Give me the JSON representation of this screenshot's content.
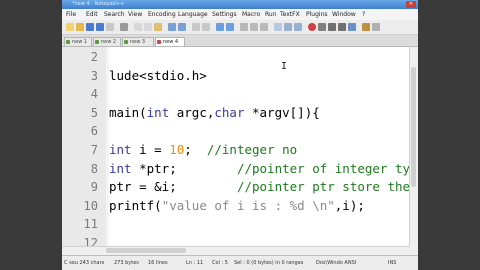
{
  "window": {
    "title": "*new 4 - Notepad++"
  },
  "menu": [
    "File",
    "Edit",
    "Search",
    "View",
    "Encoding",
    "Language",
    "Settings",
    "Macro",
    "Run",
    "TextFX",
    "Plugins",
    "Window",
    "?"
  ],
  "tabs": [
    {
      "label": "new 1",
      "active": false
    },
    {
      "label": "new 2",
      "active": false
    },
    {
      "label": "new 3",
      "active": false
    },
    {
      "label": "new 4",
      "active": true
    }
  ],
  "editor": {
    "lines": [
      {
        "n": "2",
        "code": ""
      },
      {
        "n": "3",
        "code": "lude<stdio.h>"
      },
      {
        "n": "4",
        "code": ""
      },
      {
        "n": "5",
        "code": "main(int argc,char *argv[]){"
      },
      {
        "n": "6",
        "code": ""
      },
      {
        "n": "7",
        "code": "int i = 10;  //integer no"
      },
      {
        "n": "8",
        "code": "int *ptr;        //pointer of integer ty"
      },
      {
        "n": "9",
        "code": "ptr = &i;        //pointer ptr store the"
      },
      {
        "n": "10",
        "code": "printf(\"value of i is : %d \\n\",i);"
      },
      {
        "n": "11",
        "code": ""
      },
      {
        "n": "12",
        "code": ""
      }
    ]
  },
  "status": {
    "type": "C sou 243 chars",
    "bytes": "273 bytes",
    "lines": "16 lines",
    "position": "Ln : 11",
    "col": "Col : 5",
    "sel": "Sel : 0 (0 bytes) in 0 ranges",
    "eol": "Dos\\Windo ANSI",
    "mode": "INS"
  }
}
